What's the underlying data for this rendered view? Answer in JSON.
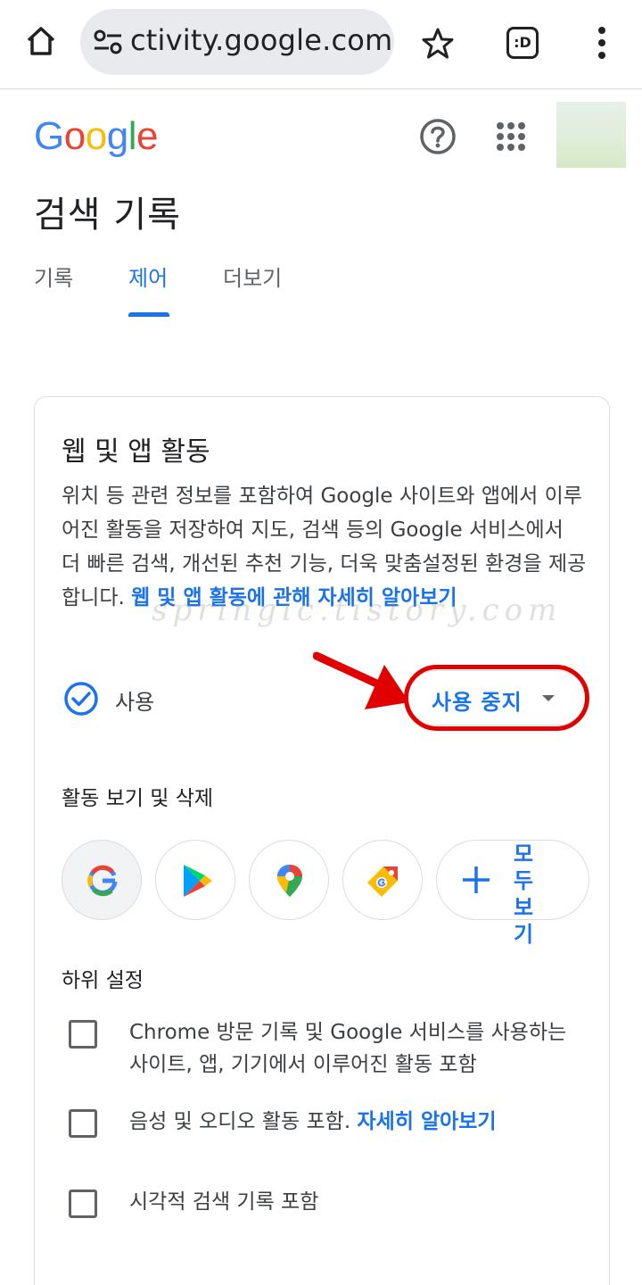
{
  "browser": {
    "url": "ctivity.google.com",
    "tab_switcher_label": ":D"
  },
  "header": {
    "logo_letters": [
      "G",
      "o",
      "o",
      "g",
      "l",
      "e"
    ]
  },
  "page": {
    "title": "검색 기록",
    "tabs": [
      {
        "label": "기록",
        "active": false
      },
      {
        "label": "제어",
        "active": true
      },
      {
        "label": "더보기",
        "active": false
      }
    ]
  },
  "card": {
    "title": "웹 및 앱 활동",
    "description": "위치 등 관련 정보를 포함하여 Google 사이트와 앱에서 이루어진 활동을 저장하여 지도, 검색 등의 Google 서비스에서 더 빠른 검색, 개선된 추천 기능, 더욱 맞춤설정된 환경을 제공합니다.",
    "learn_more_link": "웹 및 앱 활동에 관해 자세히 알아보기",
    "status_label": "사용",
    "pause_button_label": "사용 중지",
    "view_delete_label": "활동 보기 및 삭제",
    "apps": [
      "google-icon",
      "play-store-icon",
      "maps-icon",
      "shopping-tag-icon"
    ],
    "see_all_label": "모두보기",
    "subsettings_label": "하위 설정",
    "subsettings": [
      {
        "text": "Chrome 방문 기록 및 Google 서비스를 사용하는 사이트, 앱, 기기에서 이루어진 활동 포함",
        "checked": false
      },
      {
        "text": "음성 및 오디오 활동 포함.",
        "link": "자세히 알아보기",
        "checked": false
      },
      {
        "text": "시각적 검색 기록 포함",
        "checked": false
      }
    ]
  },
  "watermark": "springic.tistory.com",
  "colors": {
    "accent": "#1a73e8",
    "highlight_red": "#e00000",
    "border": "#dadce0"
  }
}
